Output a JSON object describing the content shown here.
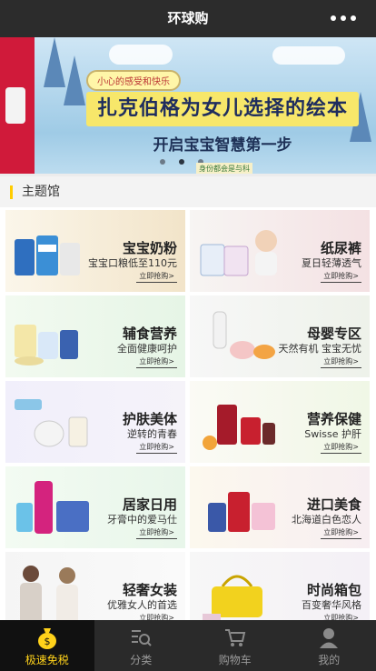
{
  "header": {
    "title": "环球购"
  },
  "banner": {
    "chip": "小心的感受和快乐",
    "headline": "扎克伯格为女儿选择的绘本",
    "subline": "开启宝宝智慧第一步",
    "sticker": "身份都会是与科学的",
    "slide_count": 3,
    "active_slide": 2
  },
  "section": {
    "title": "主题馆"
  },
  "categories": [
    {
      "title": "宝宝奶粉",
      "subtitle": "宝宝口粮低至110元",
      "cta": "立即抢购>"
    },
    {
      "title": "纸尿裤",
      "subtitle": "夏日轻薄透气",
      "cta": "立即抢购>"
    },
    {
      "title": "辅食营养",
      "subtitle": "全面健康呵护",
      "cta": "立即抢购>"
    },
    {
      "title": "母婴专区",
      "subtitle": "天然有机 宝宝无忧",
      "cta": "立即抢购>"
    },
    {
      "title": "护肤美体",
      "subtitle": "逆转的青春",
      "cta": "立即抢购>"
    },
    {
      "title": "营养保健",
      "subtitle": "Swisse 护肝",
      "cta": "立即抢购>"
    },
    {
      "title": "居家日用",
      "subtitle": "牙膏中的爱马仕",
      "cta": "立即抢购>"
    },
    {
      "title": "进口美食",
      "subtitle": "北海道白色恋人",
      "cta": "立即抢购>"
    },
    {
      "title": "轻奢女装",
      "subtitle": "优雅女人的首选",
      "cta": "立即抢购>"
    },
    {
      "title": "时尚箱包",
      "subtitle": "百变奢华风格",
      "cta": "立即抢购>"
    }
  ],
  "tabbar": [
    {
      "label": "极速免税",
      "icon": "money-bag-icon",
      "active": true
    },
    {
      "label": "分类",
      "icon": "search-list-icon",
      "active": false
    },
    {
      "label": "购物车",
      "icon": "cart-icon",
      "active": false
    },
    {
      "label": "我的",
      "icon": "user-icon",
      "active": false
    }
  ],
  "colors": {
    "accent": "#ffd21a",
    "header_bg": "#2c2c2c",
    "tabbar_bg": "#2a2a2a"
  }
}
